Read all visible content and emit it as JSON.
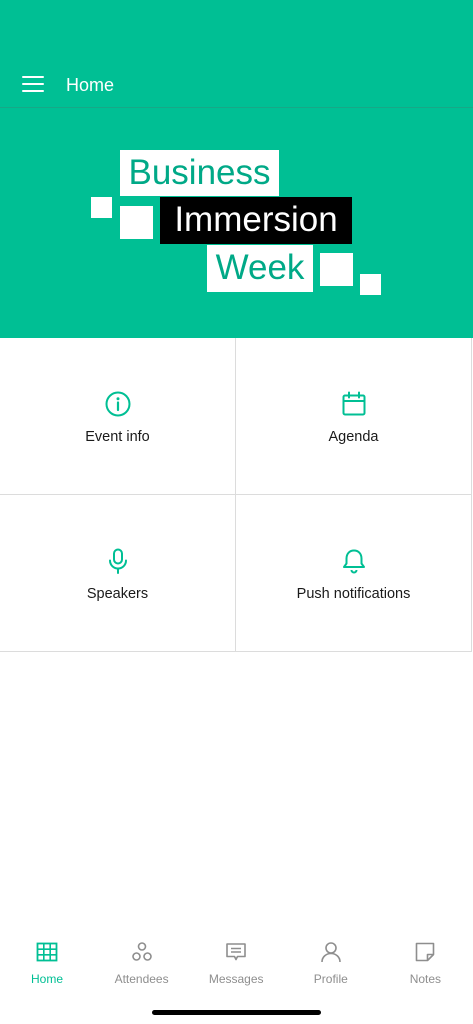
{
  "header": {
    "title": "Home"
  },
  "banner": {
    "line1": "Business",
    "line2": "Immersion",
    "line3": "Week"
  },
  "tiles": [
    {
      "label": "Event info",
      "icon": "info-icon"
    },
    {
      "label": "Agenda",
      "icon": "calendar-icon"
    },
    {
      "label": "Speakers",
      "icon": "microphone-icon"
    },
    {
      "label": "Push notifications",
      "icon": "bell-icon"
    }
  ],
  "tabbar": {
    "items": [
      {
        "label": "Home",
        "icon": "grid-icon",
        "active": true
      },
      {
        "label": "Attendees",
        "icon": "people-icon",
        "active": false
      },
      {
        "label": "Messages",
        "icon": "message-icon",
        "active": false
      },
      {
        "label": "Profile",
        "icon": "person-icon",
        "active": false
      },
      {
        "label": "Notes",
        "icon": "note-icon",
        "active": false
      }
    ]
  },
  "colors": {
    "accent": "#00bf94",
    "inactive": "#8e8e8e",
    "logo_text": "#00a987"
  }
}
